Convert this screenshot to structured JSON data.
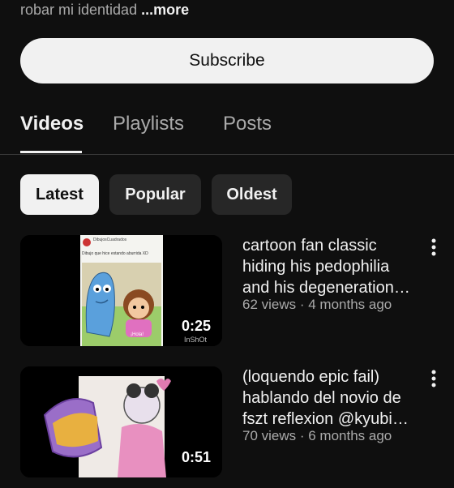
{
  "description": {
    "text": "robar mi identidad ",
    "more": "...more"
  },
  "subscribe_label": "Subscribe",
  "tabs": [
    {
      "label": "Videos",
      "active": true
    },
    {
      "label": "Playlists",
      "active": false
    },
    {
      "label": "Posts",
      "active": false
    }
  ],
  "chips": [
    {
      "label": "Latest",
      "selected": true
    },
    {
      "label": "Popular",
      "selected": false
    },
    {
      "label": "Oldest",
      "selected": false
    }
  ],
  "videos": [
    {
      "title_lines": [
        "cartoon fan classic",
        "hiding his pedophilia",
        "and his degeneration…"
      ],
      "meta": "62 views · 4 months ago",
      "duration": "0:25",
      "thumbnail": {
        "post_header": "DibujosCuadrados",
        "post_text": "Dibujo que hice estando aburrida XD",
        "bubble_text": "¡Hola!",
        "watermark": "InShOt"
      }
    },
    {
      "title_lines": [
        "(loquendo epic fail)",
        "hablando del novio de",
        "fszt reflexion @kyubi…"
      ],
      "meta": "70 views · 6 months ago",
      "duration": "0:51"
    }
  ],
  "icons": {
    "menu": "more-vert-icon"
  }
}
